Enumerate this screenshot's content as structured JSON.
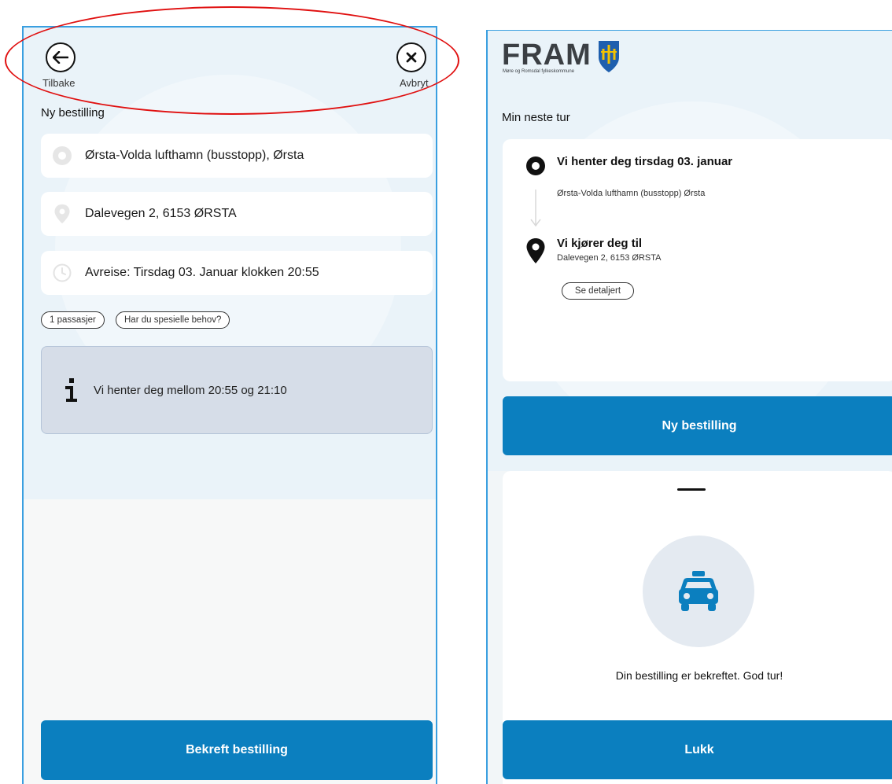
{
  "left": {
    "header": {
      "back_label": "Tilbake",
      "cancel_label": "Avbryt",
      "page_title": "Ny bestilling"
    },
    "from": {
      "text": "Ørsta-Volda lufthamn (busstopp), Ørsta",
      "icon": "circle-marker-icon"
    },
    "to": {
      "text": "Dalevegen 2, 6153 ØRSTA",
      "icon": "map-pin-icon"
    },
    "departure": {
      "text": "Avreise: Tirsdag 03. Januar klokken 20:55",
      "icon": "clock-icon"
    },
    "chips": {
      "passengers": "1 passasjer",
      "special_needs": "Har du spesielle behov?"
    },
    "info": {
      "text": "Vi henter deg mellom 20:55 og 21:10",
      "icon": "info-icon"
    },
    "confirm_button": "Bekreft bestilling"
  },
  "right": {
    "logo": {
      "brand": "FRAM",
      "tagline": "Møre og Romsdal fylkeskommune"
    },
    "section_title": "Min neste tur",
    "trip": {
      "pickup_title": "Vi henter deg tirsdag 03. januar",
      "pickup_place": "Ørsta-Volda lufthamn (busstopp) Ørsta",
      "dropoff_title": "Vi kjører deg til",
      "dropoff_place": "Dalevegen 2, 6153 ØRSTA",
      "details_button": "Se detaljert"
    },
    "new_order_button": "Ny bestilling",
    "sheet": {
      "message": "Din bestilling er bekreftet. God tur!",
      "close_button": "Lukk",
      "icon": "taxi-icon"
    }
  },
  "colors": {
    "primary": "#0b7fbf",
    "annotation": "#e01010",
    "frame": "#3a9fe0",
    "info_bg": "#d6dde8"
  }
}
